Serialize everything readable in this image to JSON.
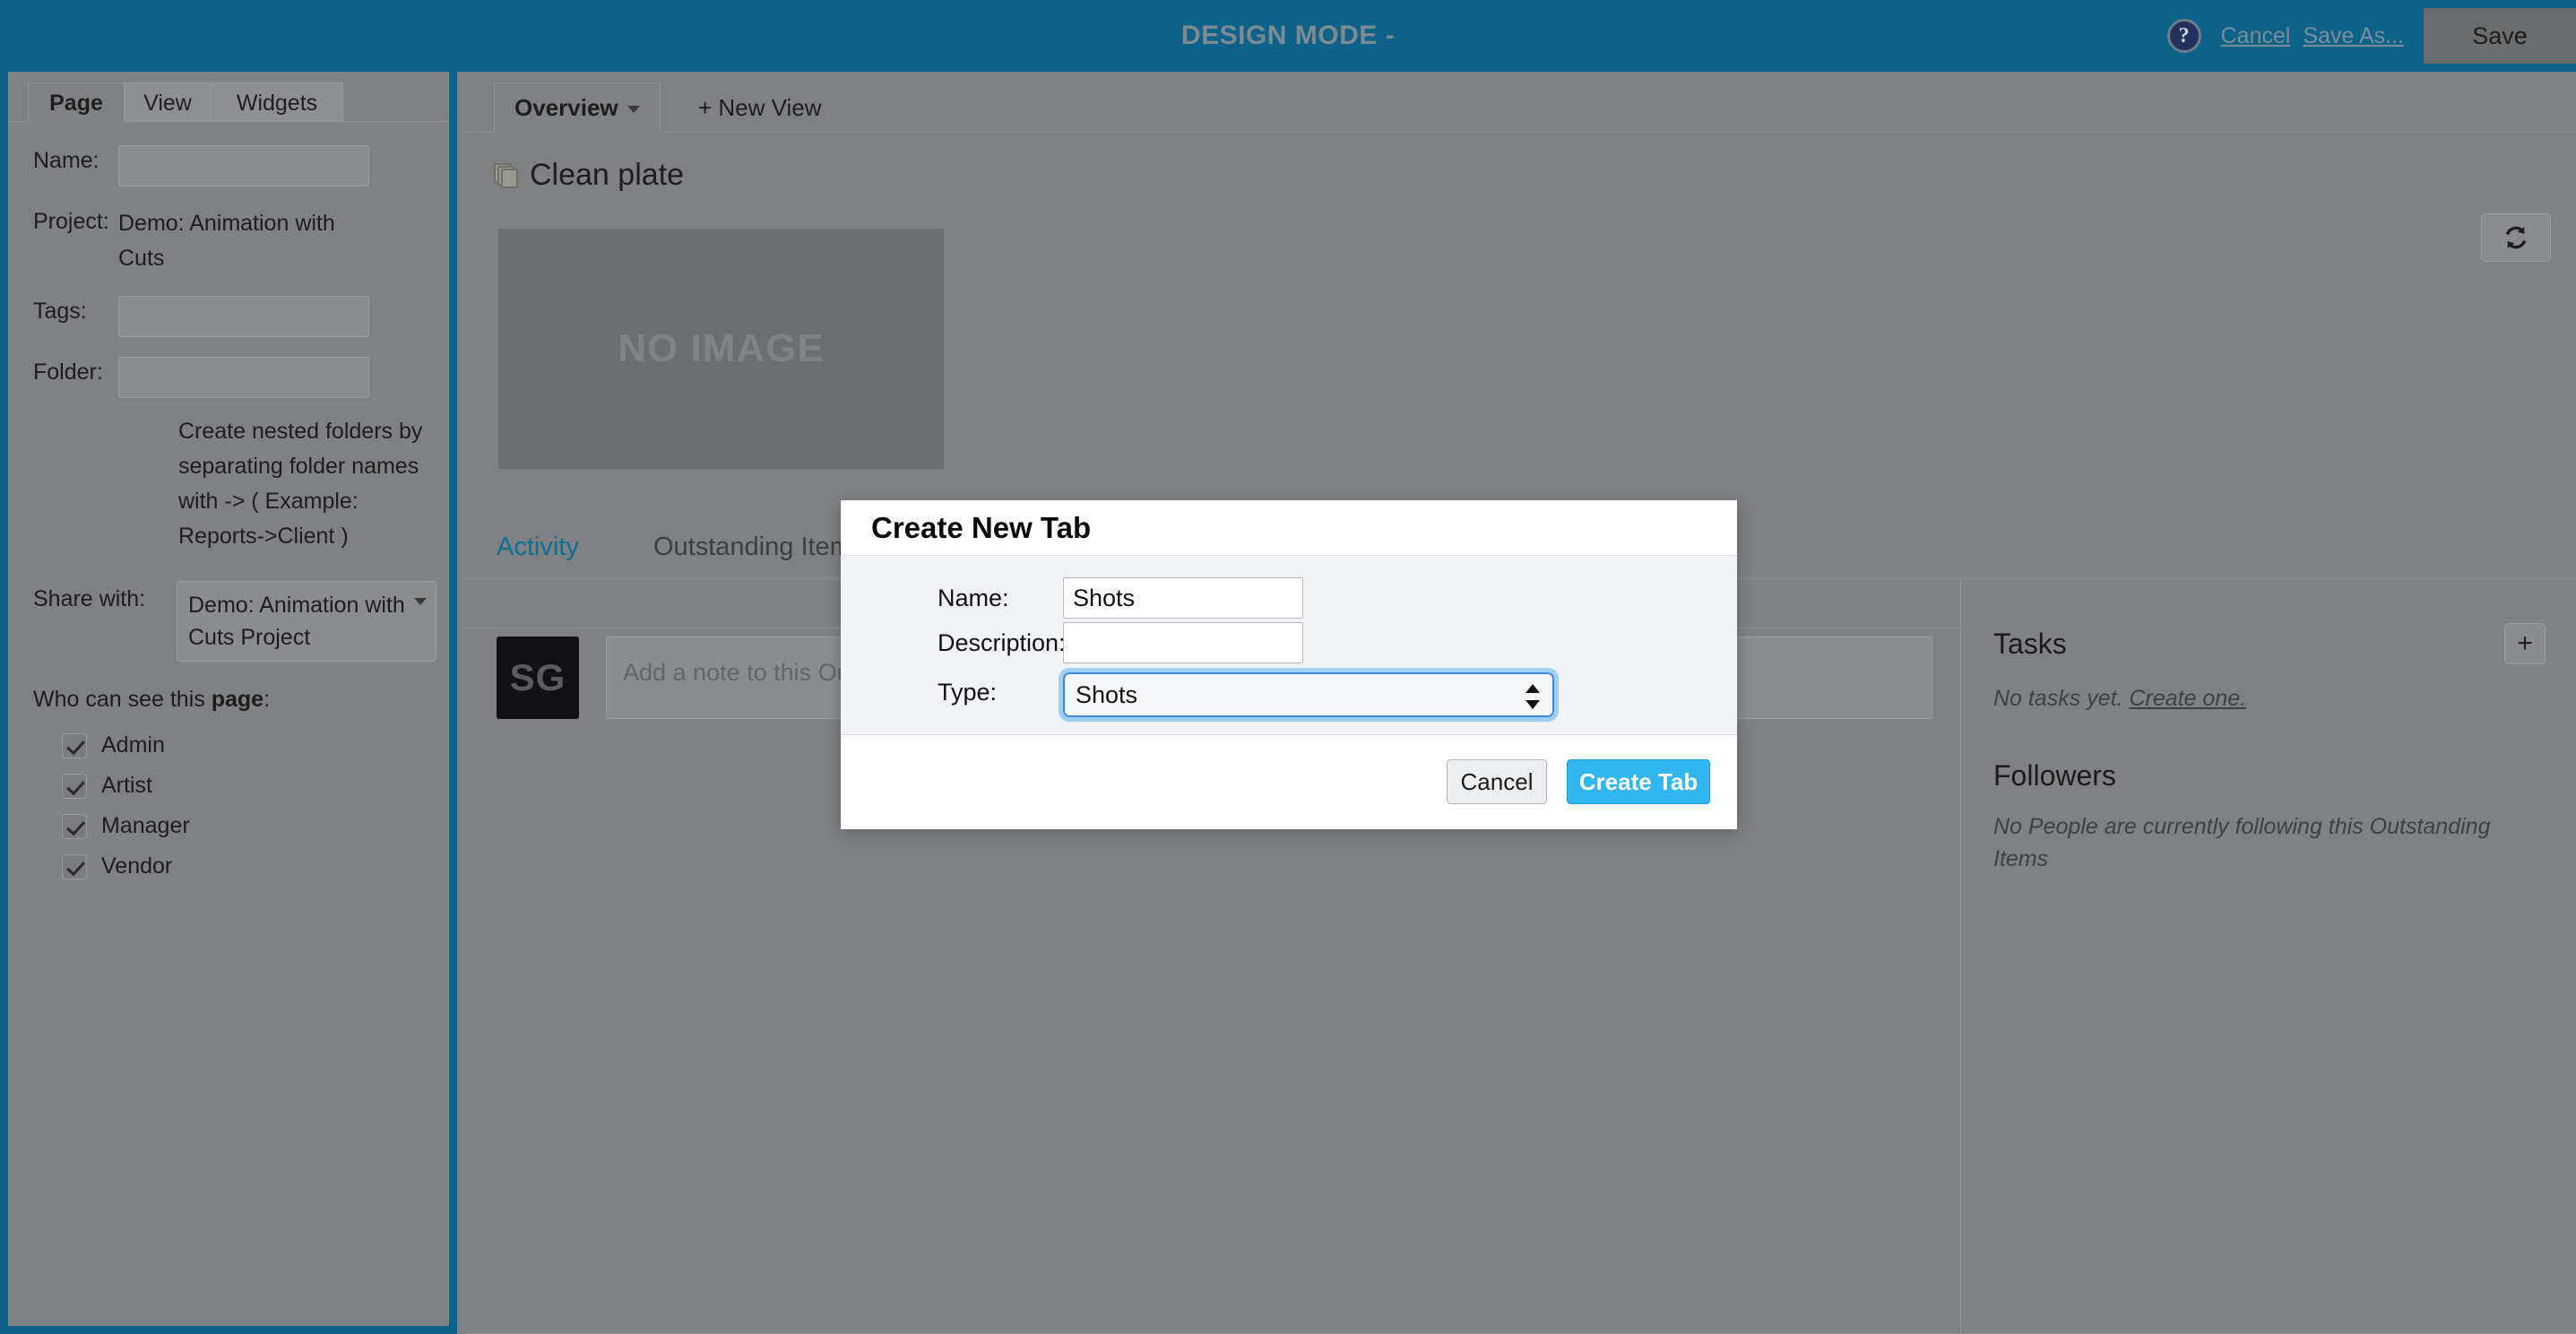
{
  "topbar": {
    "title": "DESIGN MODE -",
    "help_icon": "question-mark-circle-icon",
    "cancel_label": "Cancel",
    "save_as_label": "Save As...",
    "save_label": "Save",
    "background_color": "#0c6289"
  },
  "left_panel": {
    "tabs": [
      {
        "label": "Page",
        "active": true
      },
      {
        "label": "View",
        "active": false
      },
      {
        "label": "Widgets",
        "active": false
      }
    ],
    "fields": {
      "name_label": "Name:",
      "name_value": "",
      "project_label": "Project:",
      "project_value": "Demo: Animation with Cuts",
      "tags_label": "Tags:",
      "tags_value": "",
      "folder_label": "Folder:",
      "folder_value": ""
    },
    "helper_text": "Create nested folders by separating folder names with -> ( Example: Reports->Client )",
    "share_label": "Share with:",
    "share_value": "Demo: Animation with Cuts Project",
    "who_prefix": "Who can see this ",
    "who_bold": "page",
    "who_suffix": ":",
    "roles": [
      {
        "label": "Admin",
        "checked": true
      },
      {
        "label": "Artist",
        "checked": true
      },
      {
        "label": "Manager",
        "checked": true
      },
      {
        "label": "Vendor",
        "checked": true
      }
    ]
  },
  "main": {
    "view_tabs": {
      "overview_label": "Overview",
      "new_view_label": "+ New View"
    },
    "page_title": "Clean plate",
    "thumbnail_placeholder": "NO IMAGE",
    "refresh_icon": "refresh-icon",
    "detail_tabs": [
      {
        "label": "Activity",
        "active": true
      },
      {
        "label": "Outstanding Items",
        "active": false
      }
    ],
    "note": {
      "avatar_initials": "SG",
      "placeholder": "Add a note to this Outstanding Items"
    },
    "tasks": {
      "title": "Tasks",
      "add_label": "+",
      "empty_prefix": "No tasks yet. ",
      "empty_link": "Create one."
    },
    "followers": {
      "title": "Followers",
      "empty_text": "No People are currently following this Outstanding Items"
    }
  },
  "modal": {
    "title": "Create New Tab",
    "name_label": "Name:",
    "name_value": "Shots",
    "description_label": "Description:",
    "description_value": "",
    "type_label": "Type:",
    "type_value": "Shots",
    "cancel_label": "Cancel",
    "create_label": "Create Tab",
    "accent_color": "#31b6ef"
  }
}
